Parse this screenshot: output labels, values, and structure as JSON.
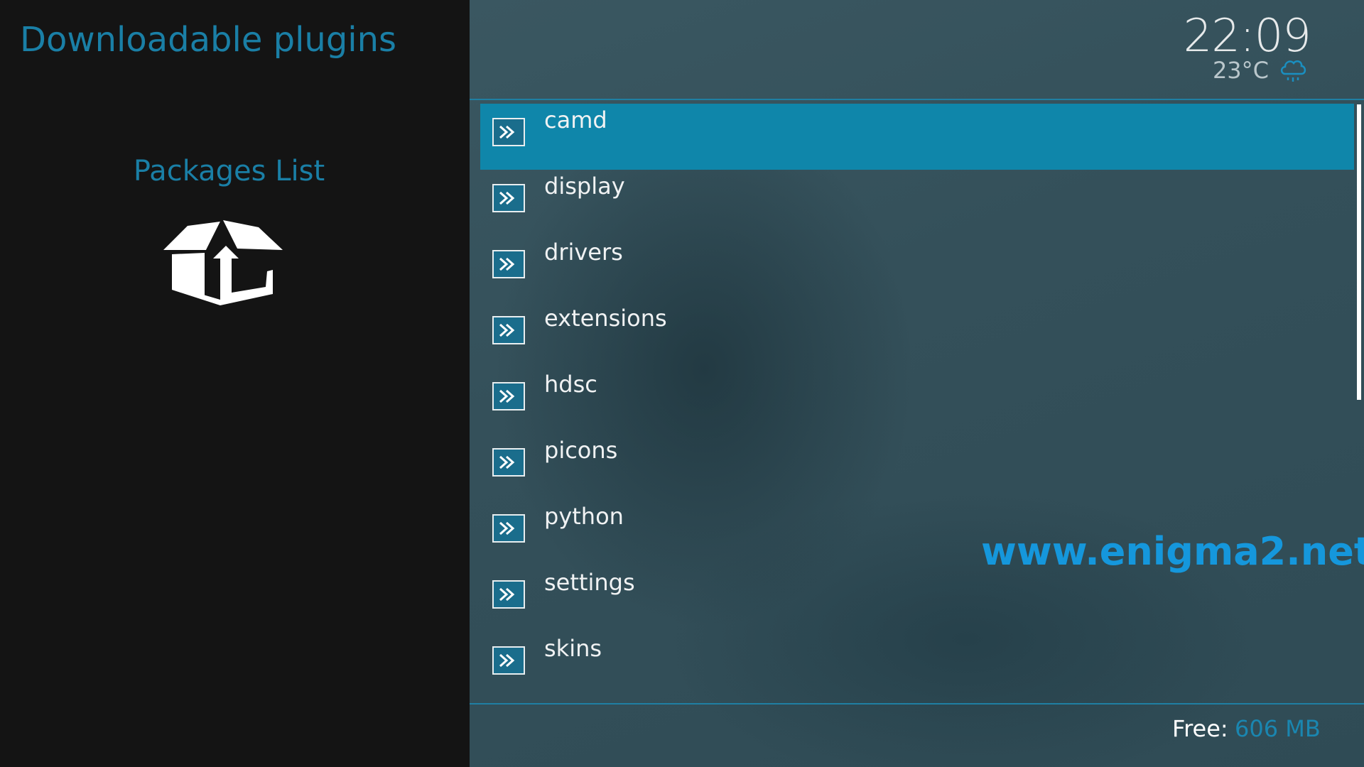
{
  "header": {
    "page_title": "Downloadable plugins",
    "clock": "22:09",
    "temperature": "23°C",
    "weather_icon": "rain-cloud-icon"
  },
  "sidebar": {
    "section_title": "Packages List",
    "section_icon": "package-box-icon"
  },
  "list": {
    "selected_index": 0,
    "items": [
      {
        "label": "camd",
        "icon": "arrow-right-icon"
      },
      {
        "label": "display",
        "icon": "arrow-right-icon"
      },
      {
        "label": "drivers",
        "icon": "arrow-right-icon"
      },
      {
        "label": "extensions",
        "icon": "arrow-right-icon"
      },
      {
        "label": "hdsc",
        "icon": "arrow-right-icon"
      },
      {
        "label": "picons",
        "icon": "arrow-right-icon"
      },
      {
        "label": "python",
        "icon": "arrow-right-icon"
      },
      {
        "label": "settings",
        "icon": "arrow-right-icon"
      },
      {
        "label": "skins",
        "icon": "arrow-right-icon"
      }
    ]
  },
  "watermark": "www.enigma2.net",
  "footer": {
    "free_label": "Free:",
    "free_value": "606 MB"
  },
  "colors": {
    "accent": "#1a7fa6",
    "selected_row": "#0f86aa",
    "watermark": "#1597dc",
    "left_background": "#141414"
  }
}
